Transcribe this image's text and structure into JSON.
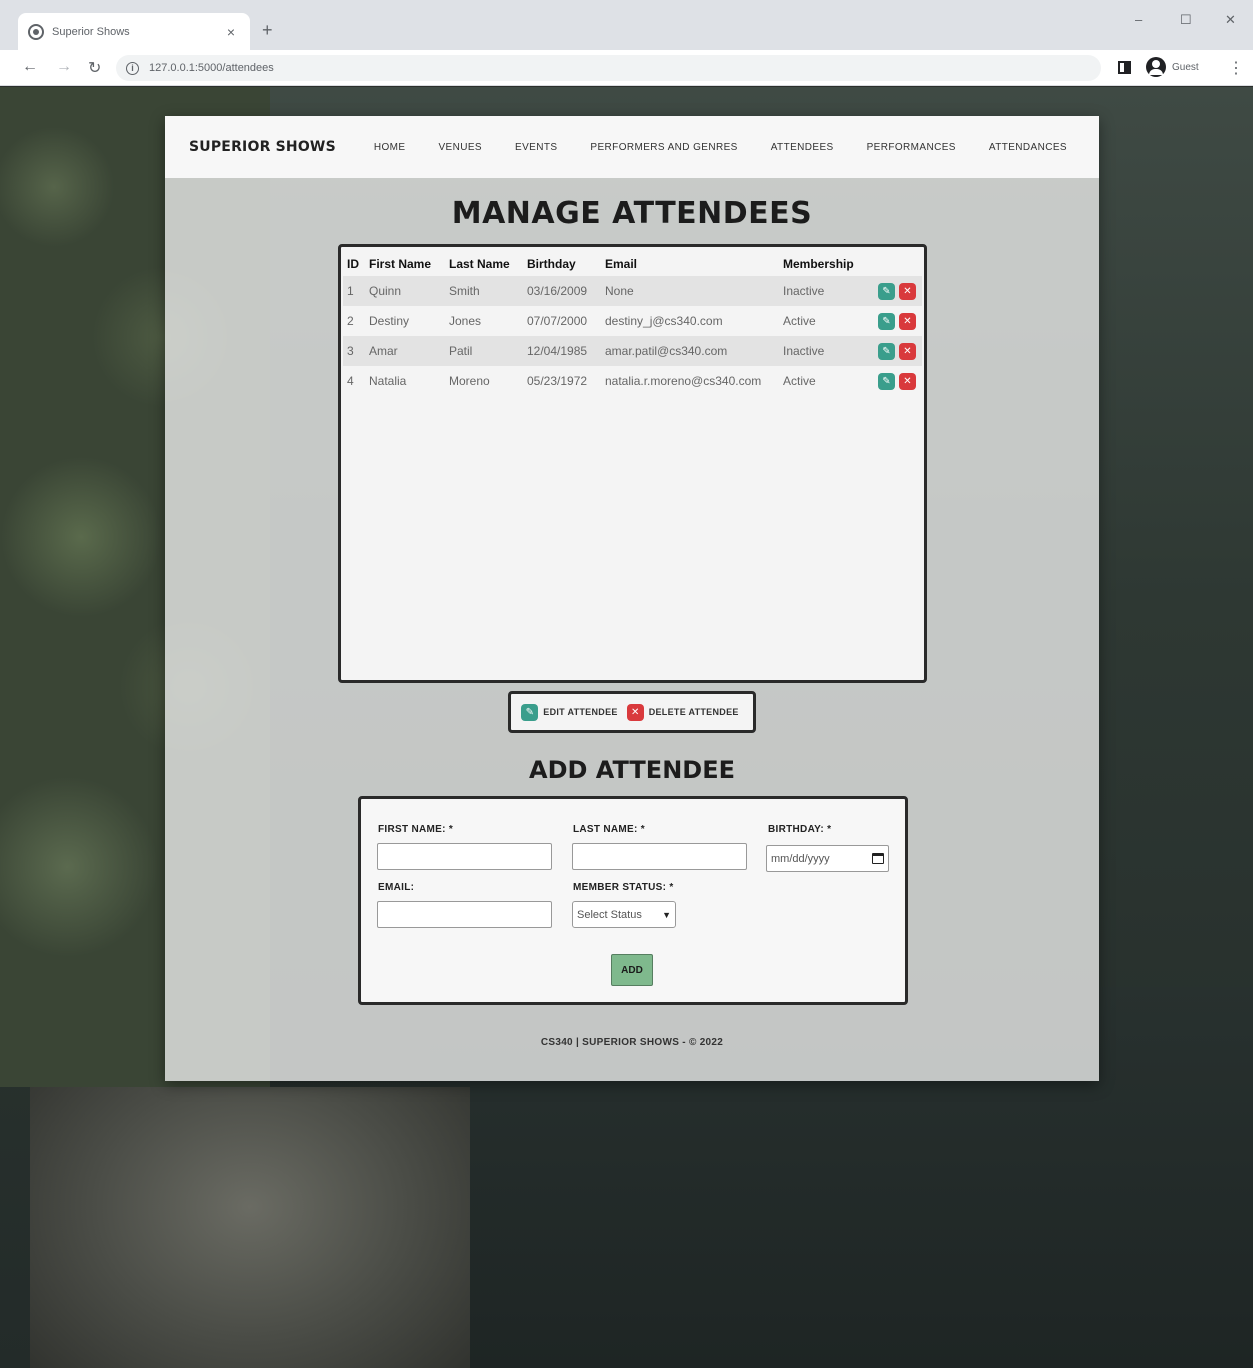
{
  "browser": {
    "tab_title": "Superior Shows",
    "tab_close": "×",
    "new_tab": "+",
    "url": "127.0.0.1:5000/attendees",
    "profile_label": "Guest",
    "minimize": "–",
    "maximize": "☐",
    "close": "✕"
  },
  "nav": {
    "brand": "SUPERIOR SHOWS",
    "items": [
      "HOME",
      "VENUES",
      "EVENTS",
      "PERFORMERS AND GENRES",
      "ATTENDEES",
      "PERFORMANCES",
      "ATTENDANCES"
    ]
  },
  "manage": {
    "title": "MANAGE ATTENDEES",
    "columns": [
      "ID",
      "First Name",
      "Last Name",
      "Birthday",
      "Email",
      "Membership"
    ],
    "rows": [
      {
        "id": "1",
        "first": "Quinn",
        "last": "Smith",
        "birthday": "03/16/2009",
        "email": "None",
        "membership": "Inactive"
      },
      {
        "id": "2",
        "first": "Destiny",
        "last": "Jones",
        "birthday": "07/07/2000",
        "email": "destiny_j@cs340.com",
        "membership": "Active"
      },
      {
        "id": "3",
        "first": "Amar",
        "last": "Patil",
        "birthday": "12/04/1985",
        "email": "amar.patil@cs340.com",
        "membership": "Inactive"
      },
      {
        "id": "4",
        "first": "Natalia",
        "last": "Moreno",
        "birthday": "05/23/1972",
        "email": "natalia.r.moreno@cs340.com",
        "membership": "Active"
      }
    ],
    "legend_edit": "EDIT ATTENDEE",
    "legend_delete": "DELETE ATTENDEE"
  },
  "add": {
    "title": "ADD ATTENDEE",
    "first_label": "FIRST NAME: *",
    "last_label": "LAST NAME: *",
    "birthday_label": "BIRTHDAY: *",
    "birthday_placeholder": "mm/dd/yyyy",
    "email_label": "EMAIL:",
    "status_label": "MEMBER STATUS: *",
    "status_value": "Select Status",
    "submit": "ADD"
  },
  "footer": "CS340 | SUPERIOR SHOWS - © 2022",
  "colors": {
    "edit": "#3a9e8c",
    "delete": "#d9393c",
    "add_button": "#7fb98d"
  }
}
